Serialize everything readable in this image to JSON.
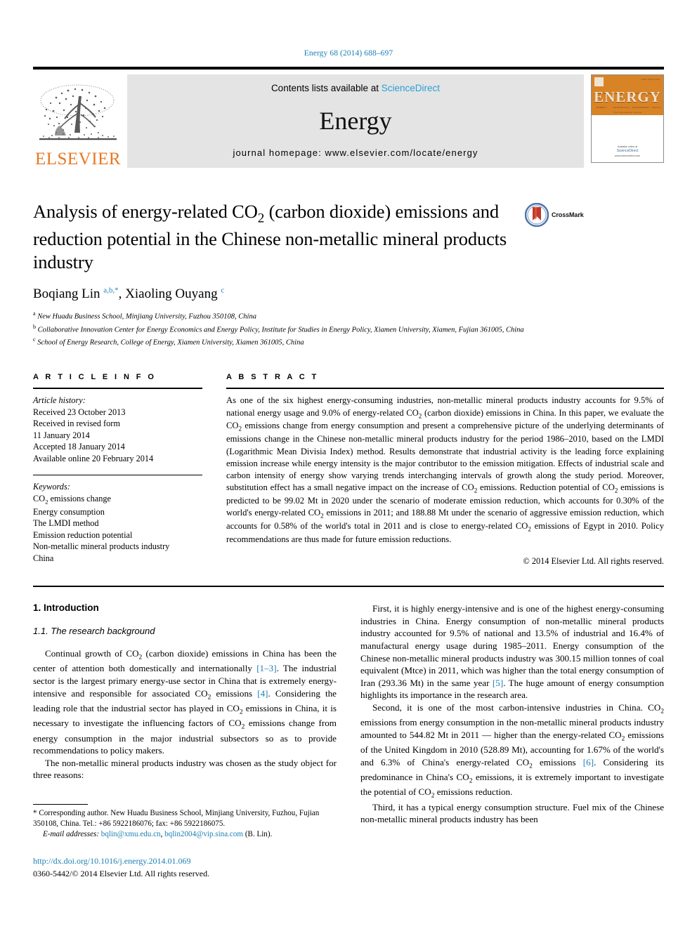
{
  "running_head": "Energy 68 (2014) 688–697",
  "masthead": {
    "publisher_name": "ELSEVIER",
    "contents_prefix": "Contents lists available at ",
    "sciencedirect": "ScienceDirect",
    "journal_name": "Energy",
    "homepage": "journal homepage: www.elsevier.com/locate/energy",
    "cover": {
      "journal_word": "ENERGY",
      "subtitle": "The International Journal",
      "available_at": "Available online at",
      "sciencedirect": "ScienceDirect",
      "url": "www.sciencedirect.com"
    }
  },
  "article": {
    "title": "Analysis of energy-related CO₂ (carbon dioxide) emissions and reduction potential in the Chinese non-metallic mineral products industry",
    "crossmark_label": "CrossMark",
    "authors_html": "Boqiang Lin <sup class=\"aff-mark\">a,b,*</sup>, Xiaoling Ouyang <sup class=\"aff-mark\">c</sup>",
    "authors_plain": "Boqiang Lin a,b,*, Xiaoling Ouyang c",
    "affiliations": [
      {
        "mark": "a",
        "text": "New Huadu Business School, Minjiang University, Fuzhou 350108, China"
      },
      {
        "mark": "b",
        "text": "Collaborative Innovation Center for Energy Economics and Energy Policy, Institute for Studies in Energy Policy, Xiamen University, Xiamen, Fujian 361005, China"
      },
      {
        "mark": "c",
        "text": "School of Energy Research, College of Energy, Xiamen University, Xiamen 361005, China"
      }
    ]
  },
  "article_info": {
    "heading": "A R T I C L E  I N F O",
    "history_label": "Article history:",
    "history": [
      "Received 23 October 2013",
      "Received in revised form",
      "11 January 2014",
      "Accepted 18 January 2014",
      "Available online 20 February 2014"
    ],
    "keywords_label": "Keywords:",
    "keywords": [
      "CO₂ emissions change",
      "Energy consumption",
      "The LMDI method",
      "Emission reduction potential",
      "Non-metallic mineral products industry",
      "China"
    ]
  },
  "abstract": {
    "heading": "A B S T R A C T",
    "text": "As one of the six highest energy-consuming industries, non-metallic mineral products industry accounts for 9.5% of national energy usage and 9.0% of energy-related CO₂ (carbon dioxide) emissions in China. In this paper, we evaluate the CO₂ emissions change from energy consumption and present a comprehensive picture of the underlying determinants of emissions change in the Chinese non-metallic mineral products industry for the period 1986–2010, based on the LMDI (Logarithmic Mean Divisia Index) method. Results demonstrate that industrial activity is the leading force explaining emission increase while energy intensity is the major contributor to the emission mitigation. Effects of industrial scale and carbon intensity of energy show varying trends interchanging intervals of growth along the study period. Moreover, substitution effect has a small negative impact on the increase of CO₂ emissions. Reduction potential of CO₂ emissions is predicted to be 99.02 Mt in 2020 under the scenario of moderate emission reduction, which accounts for 0.30% of the world's energy-related CO₂ emissions in 2011; and 188.88 Mt under the scenario of aggressive emission reduction, which accounts for 0.58% of the world's total in 2011 and is close to energy-related CO₂ emissions of Egypt in 2010. Policy recommendations are thus made for future emission reductions.",
    "copyright": "© 2014 Elsevier Ltd. All rights reserved."
  },
  "body": {
    "section_heading": "1.  Introduction",
    "subsection_heading": "1.1.  The research background",
    "left_paragraphs": [
      "Continual growth of CO₂ (carbon dioxide) emissions in China has been the center of attention both domestically and internationally [1–3]. The industrial sector is the largest primary energy-use sector in China that is extremely energy-intensive and responsible for associated CO₂ emissions [4]. Considering the leading role that the industrial sector has played in CO₂ emissions in China, it is necessary to investigate the influencing factors of CO₂ emissions change from energy consumption in the major industrial subsectors so as to provide recommendations to policy makers.",
      "The non-metallic mineral products industry was chosen as the study object for three reasons:"
    ],
    "right_paragraphs": [
      "First, it is highly energy-intensive and is one of the highest energy-consuming industries in China. Energy consumption of non-metallic mineral products industry accounted for 9.5% of national and 13.5% of industrial and 16.4% of manufactural energy usage during 1985–2011. Energy consumption of the Chinese non-metallic mineral products industry was 300.15 million tonnes of coal equivalent (Mtce) in 2011, which was higher than the total energy consumption of Iran (293.36 Mt) in the same year [5]. The huge amount of energy consumption highlights its importance in the research area.",
      "Second, it is one of the most carbon-intensive industries in China. CO₂ emissions from energy consumption in the non-metallic mineral products industry amounted to 544.82 Mt in 2011 — higher than the energy-related CO₂ emissions of the United Kingdom in 2010 (528.89 Mt), accounting for 1.67% of the world's and 6.3% of China's energy-related CO₂ emissions [6]. Considering its predominance in China's CO₂ emissions, it is extremely important to investigate the potential of CO₂ emissions reduction.",
      "Third, it has a typical energy consumption structure. Fuel mix of the Chinese non-metallic mineral products industry has been"
    ]
  },
  "footnote": {
    "corresponding": "* Corresponding author. New Huadu Business School, Minjiang University, Fuzhou, Fujian 350108, China. Tel.: +86 5922186076; fax: +86 5922186075.",
    "email_label": "E-mail addresses:",
    "email1": "bqlin@xmu.edu.cn",
    "email2": "bqlin2004@vip.sina.com",
    "email_suffix": "(B. Lin)."
  },
  "imprint": {
    "doi": "http://dx.doi.org/10.1016/j.energy.2014.01.069",
    "issn_line": "0360-5442/© 2014 Elsevier Ltd. All rights reserved."
  },
  "colors": {
    "link": "#1a7fb5",
    "sciencedirect": "#2a9fd6",
    "elsevier_orange": "#e87722",
    "masthead_bg": "#e4e4e4",
    "cover_orange": "#d98327"
  }
}
